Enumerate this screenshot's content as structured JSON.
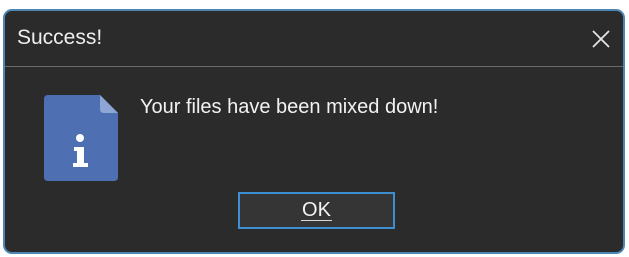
{
  "dialog": {
    "title": "Success!",
    "message": "Your files have been mixed down!",
    "ok_label": "OK",
    "icons": {
      "close": "close-icon",
      "info": "info-document-icon"
    },
    "colors": {
      "background": "#2b2b2b",
      "border": "#4b86b4",
      "ok_border": "#3e8fd2",
      "icon_blue": "#4f6fb3",
      "text": "#f2f2f2"
    }
  }
}
